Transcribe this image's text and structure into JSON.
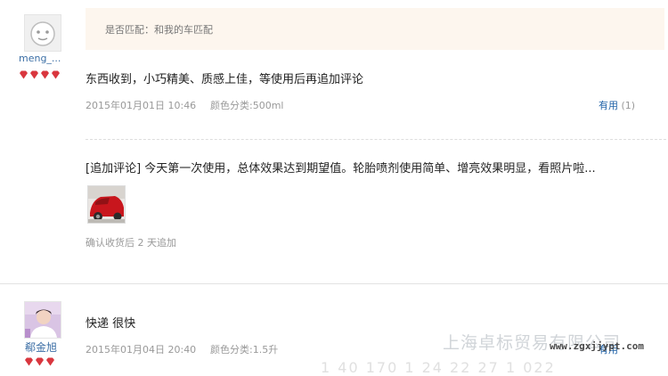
{
  "review1": {
    "username": "meng_...",
    "match_label": "是否匹配：和我的车匹配",
    "text": "东西收到，小巧精美、质感上佳，等使用后再追加评论",
    "date": "2015年01月01日 10:46",
    "spec": "颜色分类:500ml",
    "useful_label": "有用",
    "useful_count": "(1)",
    "followup_text": "[追加评论] 今天第一次使用，总体效果达到期望值。轮胎喷剂使用简单、增亮效果明显，看照片啦...",
    "followup_note": "确认收货后 2 天追加"
  },
  "review2": {
    "username": "郗金旭",
    "text": "快递 很快",
    "date": "2015年01月04日 20:40",
    "spec": "颜色分类:1.5升",
    "useful_label": "有用"
  },
  "watermark": {
    "company": "上海卓标贸易有限公司",
    "url": "www.zgxjjypt.com",
    "bottom_text": "1 40 170 1 24 22 27 1 022"
  },
  "colors": {
    "link": "#1f62a8",
    "gem": "#d9363e",
    "match_bg": "#fdf6ee"
  }
}
